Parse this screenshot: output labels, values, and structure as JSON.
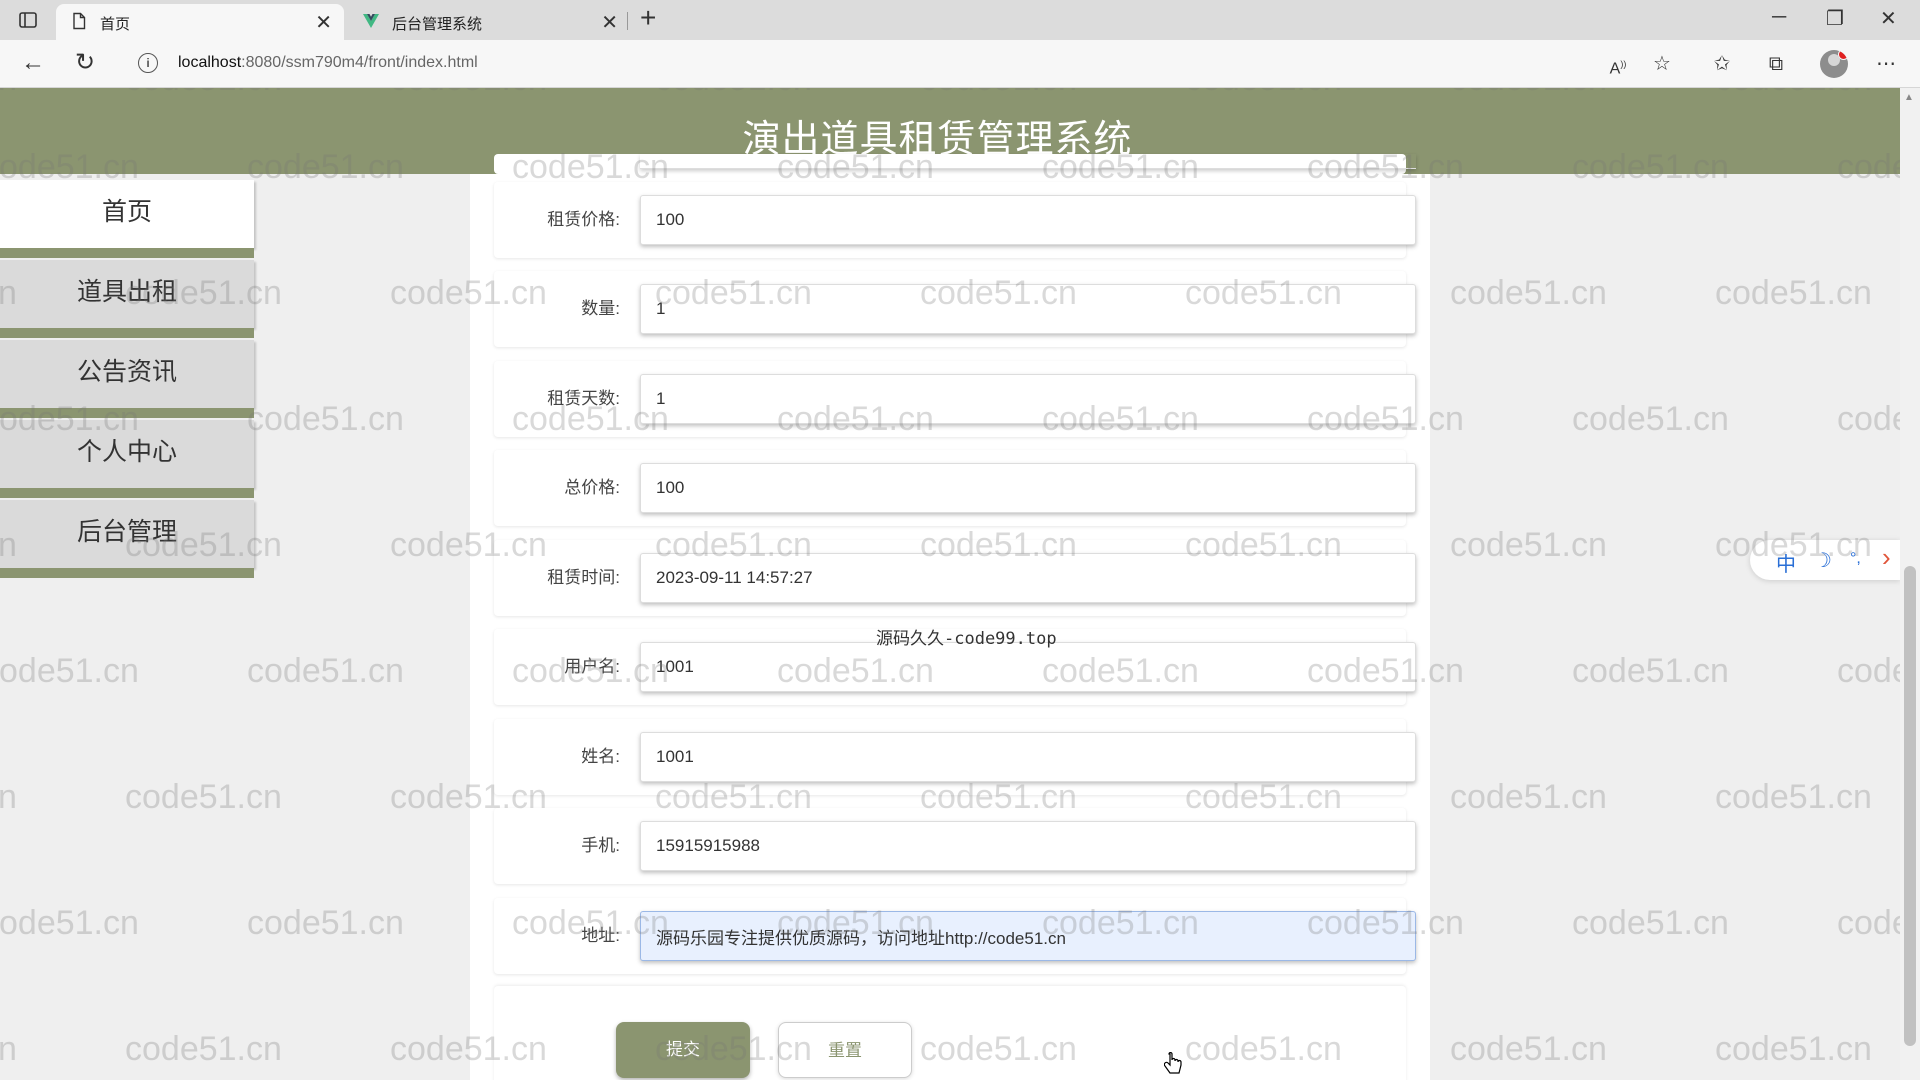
{
  "browser": {
    "tabs": [
      {
        "label": "首页",
        "icon": "page-icon",
        "active": true
      },
      {
        "label": "后台管理系统",
        "icon": "vue-logo-icon",
        "active": false
      }
    ],
    "url_host": "localhost",
    "url_path": ":8080/ssm790m4/front/index.html"
  },
  "header": {
    "title": "演出道具租赁管理系统"
  },
  "sidebar": {
    "items": [
      {
        "label": "首页"
      },
      {
        "label": "道具出租"
      },
      {
        "label": "公告资讯"
      },
      {
        "label": "个人中心"
      },
      {
        "label": "后台管理"
      }
    ]
  },
  "form": {
    "fields": [
      {
        "label": "租赁价格:",
        "value": "100"
      },
      {
        "label": "数量:",
        "value": "1"
      },
      {
        "label": "租赁天数:",
        "value": "1"
      },
      {
        "label": "总价格:",
        "value": "100"
      },
      {
        "label": "租赁时间:",
        "value": "2023-09-11 14:57:27"
      },
      {
        "label": "用户名:",
        "value": "1001"
      },
      {
        "label": "姓名:",
        "value": "1001"
      },
      {
        "label": "手机:",
        "value": "15915915988"
      },
      {
        "label": "地址:",
        "value": "源码乐园专注提供优质源码，访问地址http://code51.cn"
      }
    ],
    "submit_label": "提交",
    "reset_label": "重置"
  },
  "overlay_text": "源码久久-code99.top",
  "float_tool": {
    "lang": "中",
    "moon": "☽",
    "dots": "°,",
    "arrow": "›"
  },
  "watermark": "code51.cn",
  "colors": {
    "accent": "#8b9570",
    "focused_input": "#e8f0fe"
  }
}
